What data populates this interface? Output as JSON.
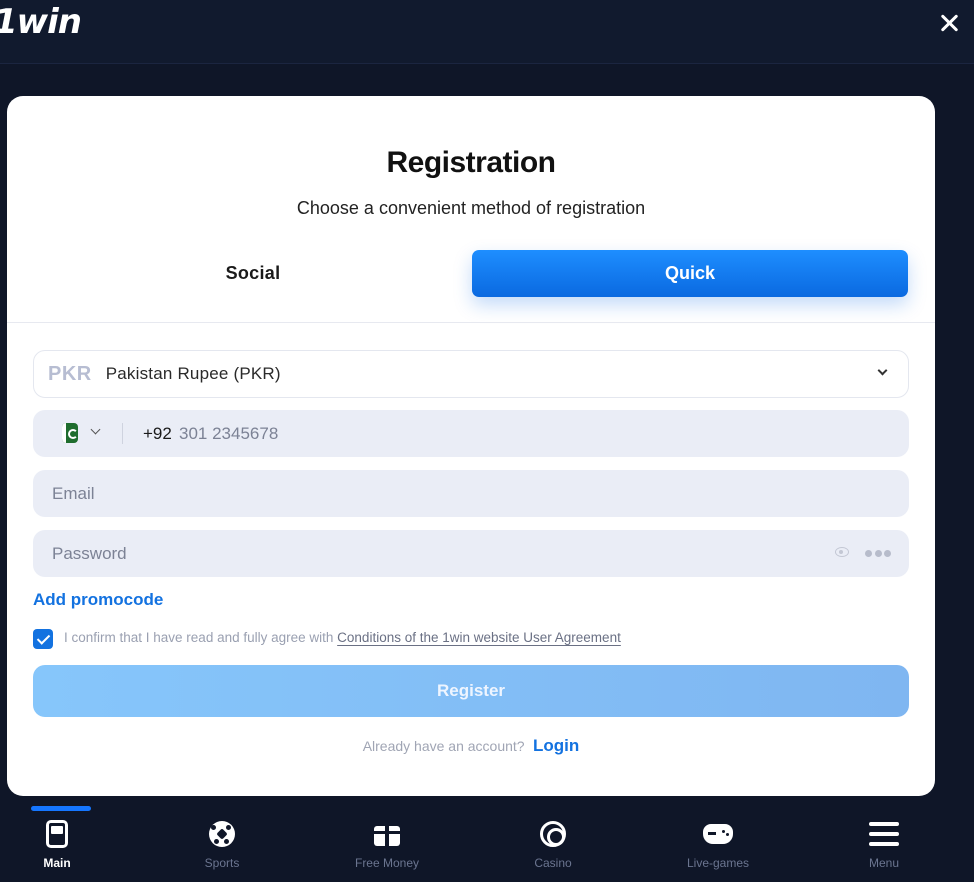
{
  "header": {
    "logo_text": "1win"
  },
  "modal": {
    "title": "Registration",
    "subtitle": "Choose a convenient method of registration",
    "tabs": [
      {
        "label": "Social",
        "active": false
      },
      {
        "label": "Quick",
        "active": true
      }
    ],
    "currency": {
      "code": "PKR",
      "name": "Pakistan Rupee (PKR)"
    },
    "phone": {
      "country_flag": "pakistan-flag-icon",
      "prefix": "+92",
      "placeholder": "301 2345678"
    },
    "email": {
      "placeholder": "Email"
    },
    "password": {
      "placeholder": "Password"
    },
    "promo_link": "Add promocode",
    "agreement": {
      "checked": true,
      "text": "I confirm that I have read and fully agree with",
      "link_text": "Conditions of the 1win website User Agreement"
    },
    "register_label": "Register",
    "login_prompt": "Already have an account?",
    "login_link": "Login"
  },
  "bottom_nav": {
    "items": [
      {
        "label": "Main",
        "icon": "phone-icon",
        "active": true
      },
      {
        "label": "Sports",
        "icon": "soccer-ball-icon",
        "active": false
      },
      {
        "label": "Free Money",
        "icon": "gift-icon",
        "active": false
      },
      {
        "label": "Casino",
        "icon": "casino-chip-icon",
        "active": false
      },
      {
        "label": "Live-games",
        "icon": "gamepad-icon",
        "active": false
      },
      {
        "label": "Menu",
        "icon": "hamburger-menu-icon",
        "active": false
      }
    ]
  },
  "colors": {
    "accent": "#1372e0",
    "background": "#0f1628",
    "tab_active": "#1e8eff"
  }
}
